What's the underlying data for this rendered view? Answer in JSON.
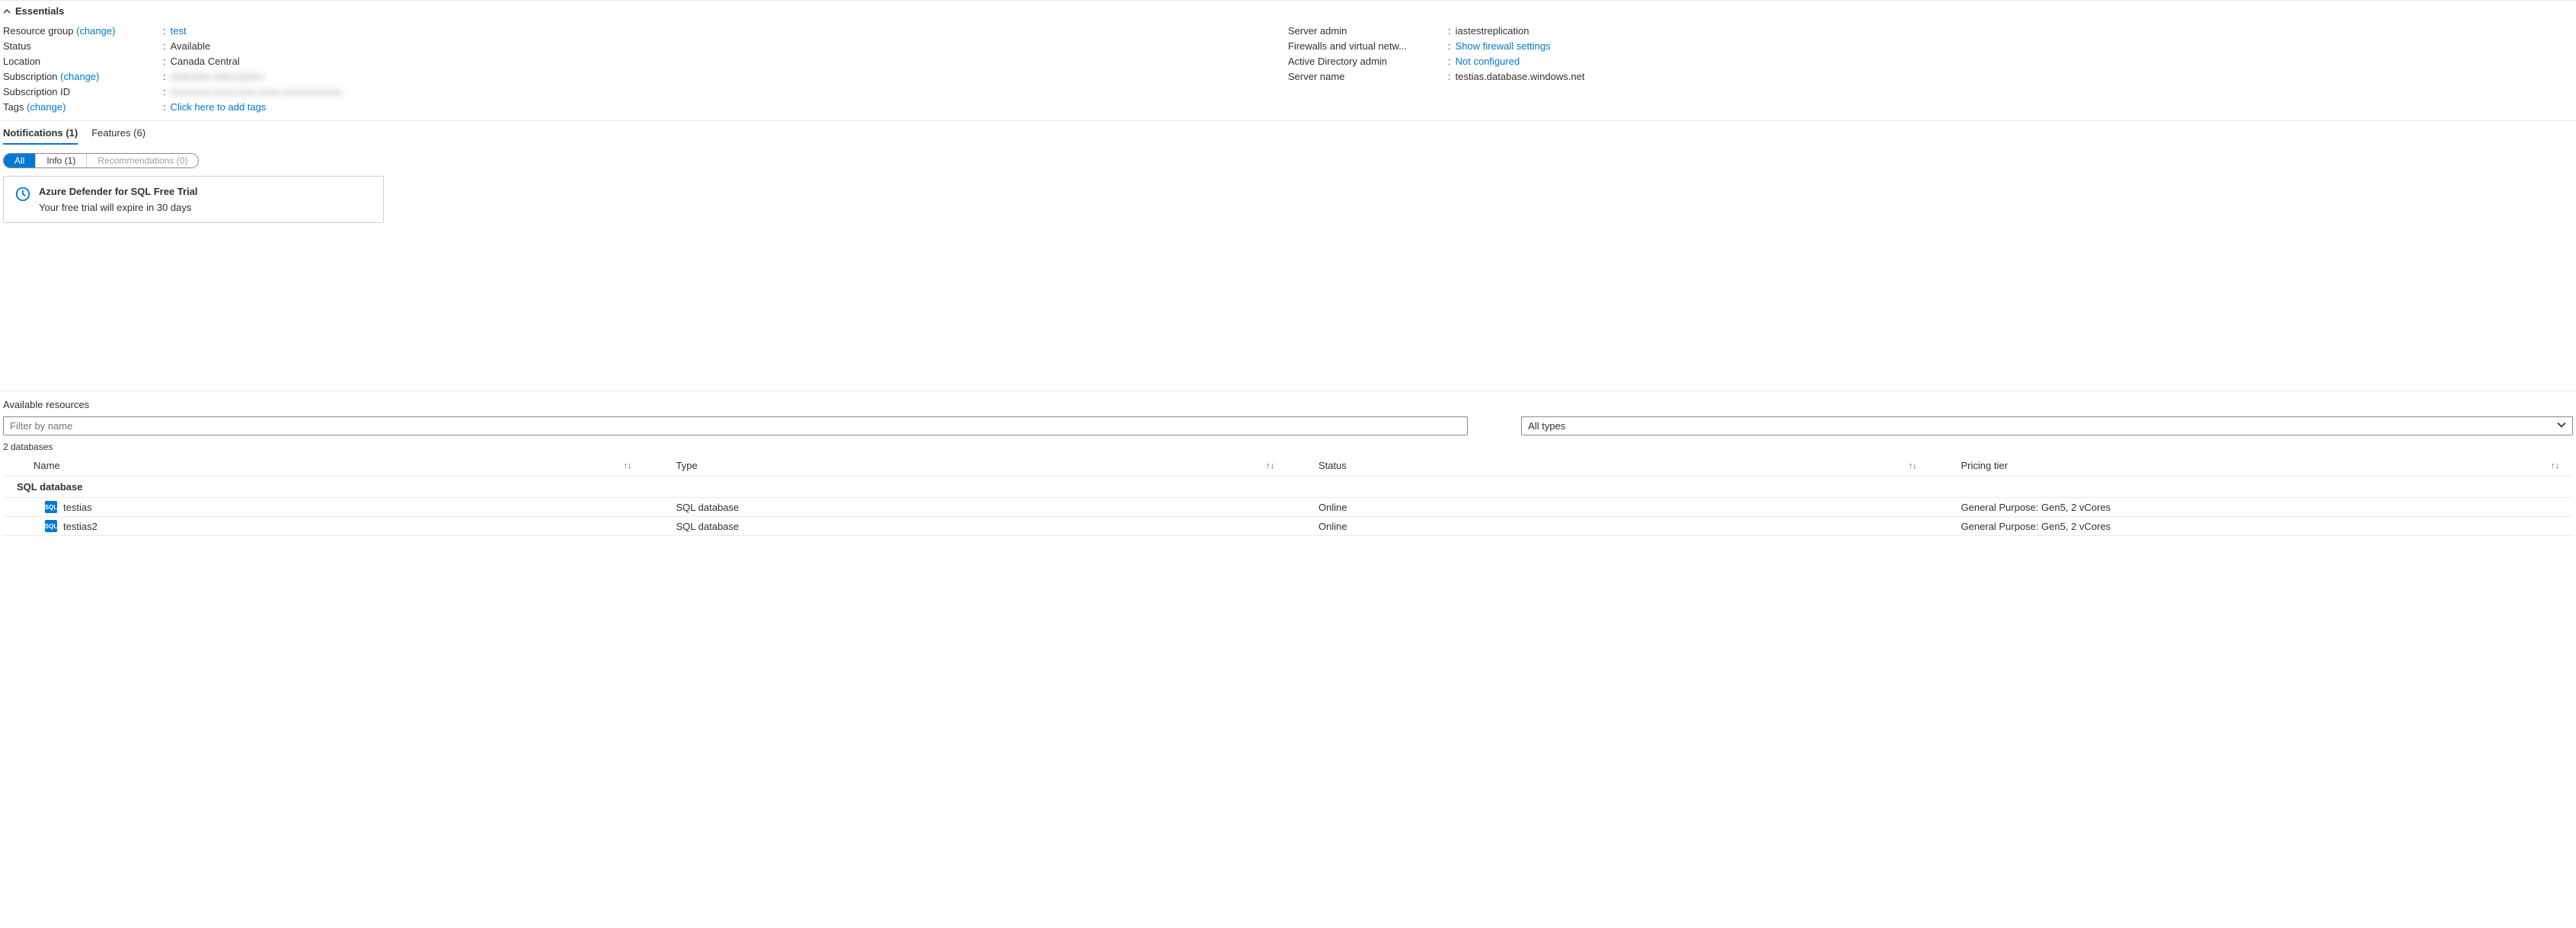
{
  "essentials": {
    "title": "Essentials",
    "left": {
      "resource_group_label": "Resource group",
      "resource_group_change": "(change)",
      "resource_group_value": "test",
      "status_label": "Status",
      "status_value": "Available",
      "location_label": "Location",
      "location_value": "Canada Central",
      "subscription_label": "Subscription",
      "subscription_change": "(change)",
      "subscription_value": "redacted subscription",
      "subscription_id_label": "Subscription ID",
      "subscription_id_value": "xxxxxxxx-xxxx-xxxx-xxxx-xxxxxxxxxxxx",
      "tags_label": "Tags",
      "tags_change": "(change)",
      "tags_value": "Click here to add tags"
    },
    "right": {
      "server_admin_label": "Server admin",
      "server_admin_value": "iastestreplication",
      "firewall_label": "Firewalls and virtual netw...",
      "firewall_value": "Show firewall settings",
      "ad_admin_label": "Active Directory admin",
      "ad_admin_value": "Not configured",
      "server_name_label": "Server name",
      "server_name_value": "testias.database.windows.net"
    }
  },
  "tabs": {
    "notifications": "Notifications (1)",
    "features": "Features (6)"
  },
  "pills": {
    "all": "All",
    "info": "Info (1)",
    "recommendations": "Recommendations (0)"
  },
  "notification": {
    "title": "Azure Defender for SQL Free Trial",
    "body": "Your free trial will expire in 30 days"
  },
  "resources": {
    "title": "Available resources",
    "filter_placeholder": "Filter by name",
    "type_select": "All types",
    "count_line": "2 databases",
    "headers": {
      "name": "Name",
      "type": "Type",
      "status": "Status",
      "pricing": "Pricing tier"
    },
    "group_header": "SQL database",
    "rows": [
      {
        "name": "testias",
        "type": "SQL database",
        "status": "Online",
        "pricing": "General Purpose: Gen5, 2 vCores"
      },
      {
        "name": "testias2",
        "type": "SQL database",
        "status": "Online",
        "pricing": "General Purpose: Gen5, 2 vCores"
      }
    ]
  }
}
